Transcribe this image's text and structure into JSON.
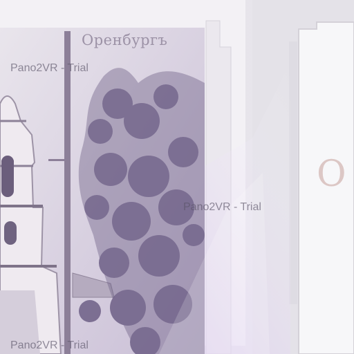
{
  "viewer": {
    "watermarks": [
      "Pano2VR - Trial",
      "Pano2VR - Trial",
      "Pano2VR - Trial"
    ]
  },
  "postcard": {
    "caption": "Оренбургъ"
  },
  "right_card": {
    "letter": "О"
  },
  "colors": {
    "frame": "#f4f2f6",
    "tint": "#b99ad8",
    "foliage": "#6d5f86"
  }
}
